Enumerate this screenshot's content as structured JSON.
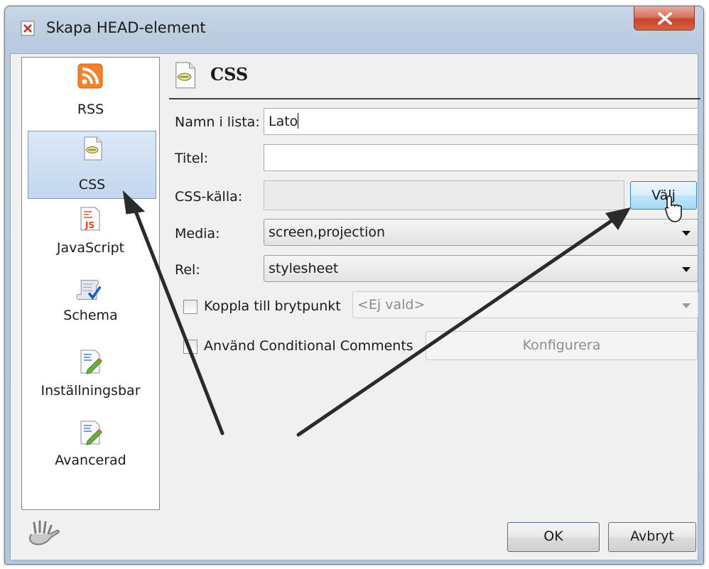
{
  "window": {
    "title": "Skapa HEAD-element"
  },
  "sidebar": {
    "items": [
      {
        "label": "RSS",
        "icon": "rss-icon"
      },
      {
        "label": "CSS",
        "icon": "css-file-icon",
        "selected": true
      },
      {
        "label": "JavaScript",
        "icon": "javascript-file-icon"
      },
      {
        "label": "Schema",
        "icon": "schema-scroll-icon"
      },
      {
        "label": "Inställningsbar",
        "icon": "edit-document-icon"
      },
      {
        "label": "Avancerad",
        "icon": "edit-document-icon"
      }
    ]
  },
  "panel": {
    "title": "CSS"
  },
  "form": {
    "name_label": "Namn i lista:",
    "name_value": "Lato",
    "title_label": "Titel:",
    "title_value": "",
    "source_label": "CSS-källa:",
    "source_value": "",
    "choose_button": "Välj",
    "media_label": "Media:",
    "media_value": "screen,projection",
    "rel_label": "Rel:",
    "rel_value": "stylesheet",
    "breakpoint_label": "Koppla till brytpunkt",
    "breakpoint_value": "<Ej vald>",
    "conditional_label": "Använd Conditional Comments",
    "configure_button": "Konfigurera"
  },
  "footer": {
    "ok": "OK",
    "cancel": "Avbryt"
  },
  "colors": {
    "selection": "#c3d7ef",
    "rss_orange": "#f2832b",
    "arrow": "#2b2b2b"
  }
}
